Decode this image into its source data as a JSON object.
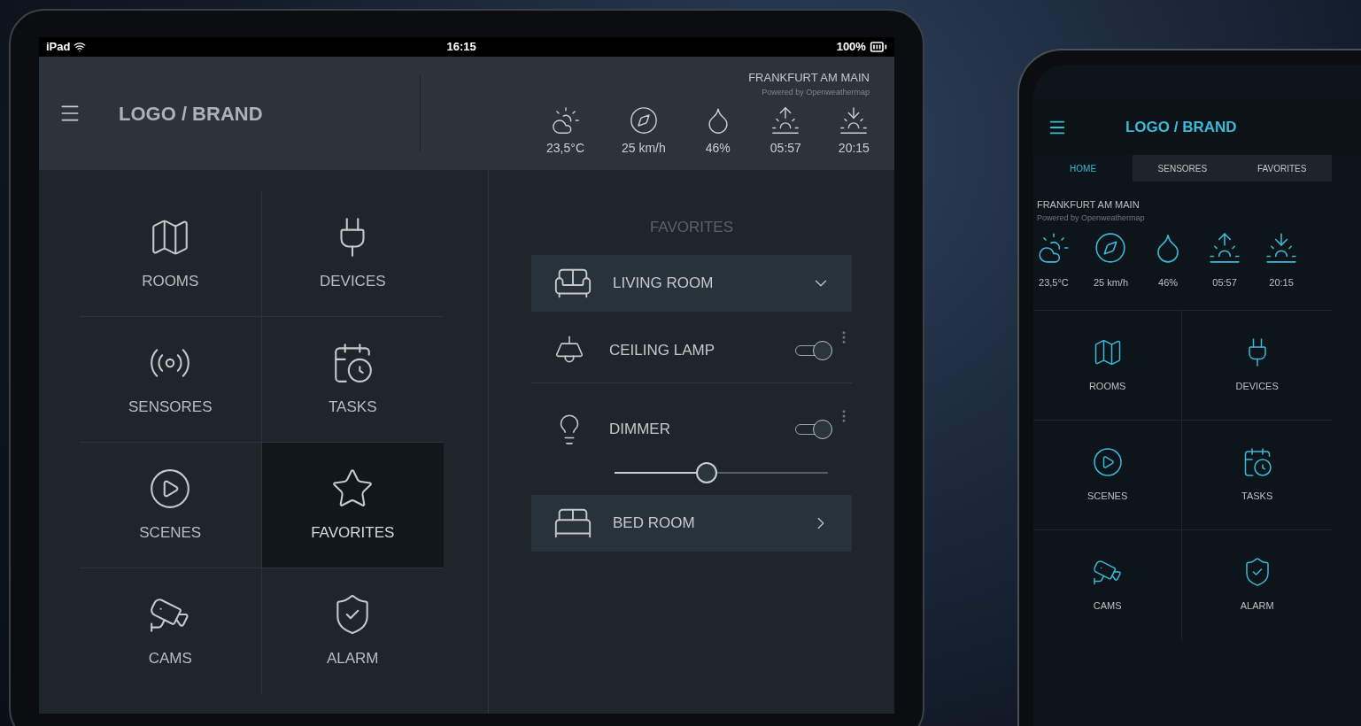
{
  "tablet": {
    "status_bar": {
      "device": "iPad",
      "time": "16:15",
      "battery": "100%"
    },
    "header": {
      "brand": "LOGO / BRAND",
      "location": "FRANKFURT AM MAIN",
      "powered_by": "Powered by Openweathermap",
      "weather": [
        {
          "kind": "cloud",
          "value": "23,5°C"
        },
        {
          "kind": "wind",
          "value": "25 km/h"
        },
        {
          "kind": "humidity",
          "value": "46%"
        },
        {
          "kind": "sunrise",
          "value": "05:57"
        },
        {
          "kind": "sunset",
          "value": "20:15"
        }
      ]
    },
    "tiles": [
      {
        "kind": "rooms",
        "label": "ROOMS",
        "selected": false
      },
      {
        "kind": "devices",
        "label": "DEVICES",
        "selected": false
      },
      {
        "kind": "sensors",
        "label": "SENSORES",
        "selected": false
      },
      {
        "kind": "tasks",
        "label": "TASKS",
        "selected": false
      },
      {
        "kind": "scenes",
        "label": "SCENES",
        "selected": false
      },
      {
        "kind": "favorites",
        "label": "FAVORITES",
        "selected": true
      },
      {
        "kind": "cams",
        "label": "CAMS",
        "selected": false
      },
      {
        "kind": "alarm",
        "label": "ALARM",
        "selected": false
      }
    ],
    "favorites": {
      "title": "FAVORITES",
      "items": [
        {
          "kind": "room",
          "label": "LIVING ROOM",
          "expanded": true
        },
        {
          "kind": "switch",
          "label": "CEILING LAMP",
          "on": true
        },
        {
          "kind": "dimmer",
          "label": "DIMMER",
          "on": true,
          "level": 0.43
        },
        {
          "kind": "room",
          "label": "BED ROOM",
          "expanded": false
        }
      ]
    }
  },
  "phone": {
    "brand": "LOGO / BRAND",
    "tabs": [
      {
        "label": "HOME",
        "selected": true
      },
      {
        "label": "SENSORES",
        "selected": false
      },
      {
        "label": "FAVORITES",
        "selected": false
      }
    ],
    "location": "FRANKFURT AM MAIN",
    "powered_by": "Powered by Openweathermap",
    "weather": [
      {
        "kind": "cloud",
        "value": "23,5°C"
      },
      {
        "kind": "wind",
        "value": "25 km/h"
      },
      {
        "kind": "humidity",
        "value": "46%"
      },
      {
        "kind": "sunrise",
        "value": "05:57"
      },
      {
        "kind": "sunset",
        "value": "20:15"
      }
    ],
    "tiles": [
      {
        "kind": "rooms",
        "label": "ROOMS"
      },
      {
        "kind": "devices",
        "label": "DEVICES"
      },
      {
        "kind": "scenes",
        "label": "SCENES"
      },
      {
        "kind": "tasks",
        "label": "TASKS"
      },
      {
        "kind": "cams",
        "label": "CAMS"
      },
      {
        "kind": "alarm",
        "label": "ALARM"
      }
    ]
  }
}
